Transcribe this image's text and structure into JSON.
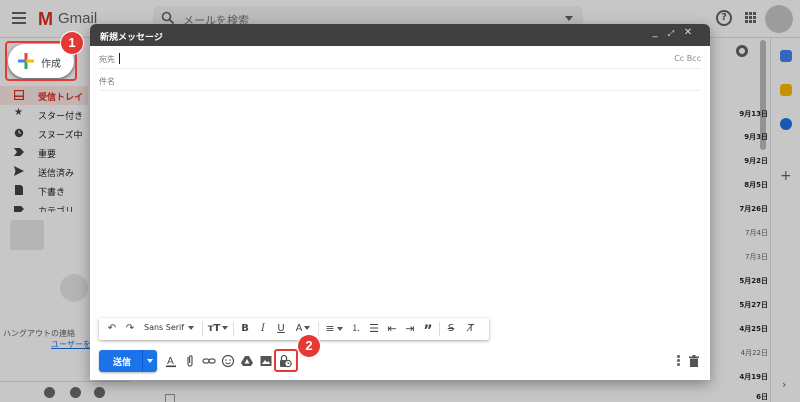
{
  "gmail": {
    "logo_text": "Gmail",
    "search_placeholder": "メールを検索",
    "compose_label": "作成",
    "nav": [
      {
        "label": "受信トレイ",
        "active": true
      },
      {
        "label": "スター付き"
      },
      {
        "label": "スヌーズ中"
      },
      {
        "label": "重要"
      },
      {
        "label": "送信済み"
      },
      {
        "label": "下書き"
      },
      {
        "label": "カテゴリ"
      }
    ],
    "hangouts_text": "ハングアウトの連絡",
    "hangouts_link": "ユーザーを",
    "dates": [
      {
        "text": "9月13日",
        "bold": true
      },
      {
        "text": "9月3日",
        "bold": true
      },
      {
        "text": "9月2日",
        "bold": true
      },
      {
        "text": "8月5日",
        "bold": true
      },
      {
        "text": "7月26日",
        "bold": true
      },
      {
        "text": "7月4日",
        "bold": false
      },
      {
        "text": "7月3日",
        "bold": false
      },
      {
        "text": "5月28日",
        "bold": true
      },
      {
        "text": "5月27日",
        "bold": true
      },
      {
        "text": "4月25日",
        "bold": true
      },
      {
        "text": "4月22日",
        "bold": false
      },
      {
        "text": "4月19日",
        "bold": true
      },
      {
        "text": "6日",
        "bold": true
      }
    ]
  },
  "compose": {
    "title": "新規メッセージ",
    "to_label": "宛先",
    "cc_bcc": "Cc Bcc",
    "subject_label": "件名",
    "font": "Sans Serif",
    "send_label": "送信"
  },
  "annotations": {
    "step1": "1",
    "step2": "2"
  },
  "colors": {
    "send": "#1a73e8",
    "highlight": "#e53935",
    "header": "#404040"
  }
}
